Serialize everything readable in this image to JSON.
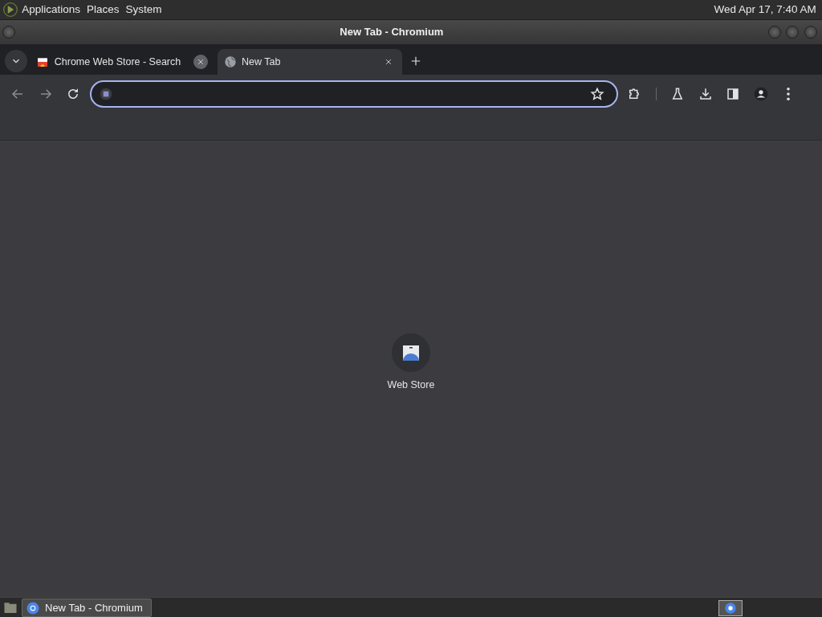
{
  "top_panel": {
    "menus": [
      "Applications",
      "Places",
      "System"
    ],
    "clock": "Wed Apr 17,  7:40 AM"
  },
  "window": {
    "title": "New Tab - Chromium"
  },
  "tabs": [
    {
      "title": "Chrome Web Store - Search",
      "selected": false
    },
    {
      "title": "New Tab",
      "selected": true
    }
  ],
  "shortcuts": [
    {
      "label": "Web Store"
    }
  ],
  "taskbar": {
    "windows": [
      {
        "label": "New Tab - Chromium",
        "selected": true
      }
    ]
  }
}
